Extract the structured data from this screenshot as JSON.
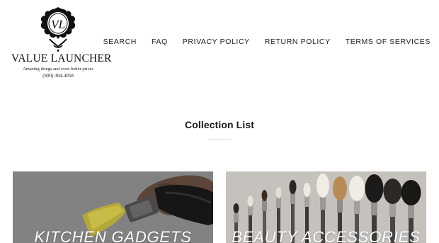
{
  "brand": {
    "name": "VALUE LAUNCHER",
    "tagline": "Amazing things and even better prices",
    "phone": "(800) 384-4058",
    "monogram": "VL"
  },
  "nav": {
    "items": [
      {
        "label": "SEARCH"
      },
      {
        "label": "FAQ"
      },
      {
        "label": "PRIVACY POLICY"
      },
      {
        "label": "RETURN POLICY"
      },
      {
        "label": "TERMS OF SERVICES"
      }
    ]
  },
  "collections": {
    "title": "Collection List",
    "cards": [
      {
        "label": "KITCHEN GADGETS"
      },
      {
        "label": "BEAUTY ACCESSORIES"
      }
    ]
  },
  "colors": {
    "text": "#1c1c1c",
    "card_overlay": "#7a7a7a",
    "card_bg_beauty": "#d9d6d2"
  }
}
